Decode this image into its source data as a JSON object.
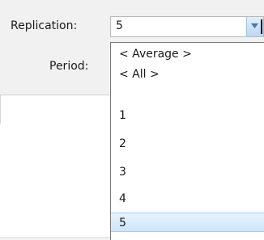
{
  "form": {
    "replication_label": "Replication:",
    "period_label": "Period:"
  },
  "combo": {
    "selected_value": "5",
    "options": [
      "< Average >",
      "< All >",
      "1",
      "2",
      "3",
      "4",
      "5"
    ],
    "selected_index": 6
  },
  "icons": {
    "dropdown_arrow": "chevron-down-icon"
  }
}
